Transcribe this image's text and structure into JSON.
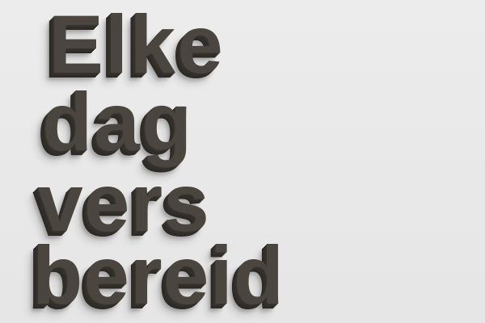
{
  "text": {
    "line1": "Elke",
    "line2": "dag",
    "line3": "vers",
    "line4": "bereid"
  },
  "colors": {
    "background": "#e9e9e9",
    "text_face": "#4a463f",
    "text_extrusion": "#2e2b26"
  }
}
